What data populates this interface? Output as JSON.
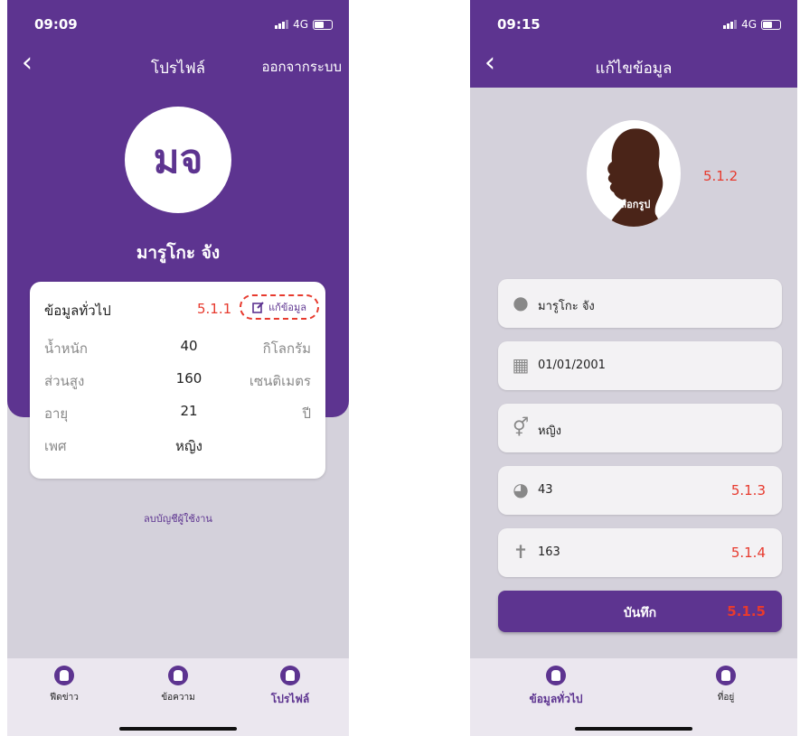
{
  "colors": {
    "brand_purple": "#5d3490",
    "annotation_red": "#e73a2e",
    "background": "#d4d1db"
  },
  "profile_screen": {
    "status": {
      "time": "09:09",
      "network": "4G"
    },
    "header": {
      "title": "โปรไฟล์",
      "logout": "ออกจากระบบ",
      "back_icon": "chevron-left-icon"
    },
    "avatar_initials": "มจ",
    "user_name": "มารูโกะ จัง",
    "card": {
      "title": "ข้อมูลทั่วไป",
      "annotation": "5.1.1",
      "edit_label": "แก้ข้อมูล",
      "rows": [
        {
          "label": "น้ำหนัก",
          "value": "40",
          "unit": "กิโลกรัม"
        },
        {
          "label": "ส่วนสูง",
          "value": "160",
          "unit": "เซนติเมตร"
        },
        {
          "label": "อายุ",
          "value": "21",
          "unit": "ปี"
        },
        {
          "label": "เพศ",
          "value": "หญิง",
          "unit": ""
        }
      ]
    },
    "delete_account": "ลบบัญชีผู้ใช้งาน",
    "tabs": [
      {
        "label": "ฟีดข่าว",
        "icon": "tooth-icon"
      },
      {
        "label": "ข้อความ",
        "icon": "tooth-icon"
      },
      {
        "label": "โปรไฟล์",
        "icon": "tooth-icon"
      }
    ]
  },
  "edit_screen": {
    "status": {
      "time": "09:15",
      "network": "4G"
    },
    "header": {
      "title": "แก้ไขข้อมูล",
      "back_icon": "chevron-left-icon"
    },
    "avatar": {
      "caption": "เลือกรูป",
      "annotation": "5.1.2"
    },
    "fields": [
      {
        "icon": "person-icon",
        "value": "มารูโกะ จัง",
        "annotation": ""
      },
      {
        "icon": "calendar-icon",
        "value": "01/01/2001",
        "annotation": ""
      },
      {
        "icon": "gender-icon",
        "value": "หญิง",
        "annotation": ""
      },
      {
        "icon": "scale-icon",
        "value": "43",
        "annotation": "5.1.3"
      },
      {
        "icon": "height-icon",
        "value": "163",
        "annotation": "5.1.4"
      }
    ],
    "save_button": {
      "label": "บันทึก",
      "annotation": "5.1.5"
    },
    "tabs": [
      {
        "label": "ข้อมูลทั่วไป",
        "icon": "tooth-icon"
      },
      {
        "label": "ที่อยู่",
        "icon": "tooth-icon"
      }
    ]
  }
}
